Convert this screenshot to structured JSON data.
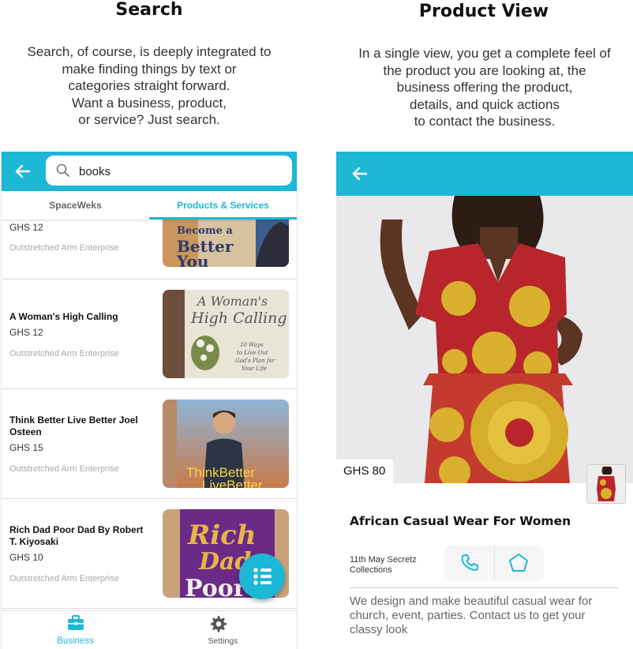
{
  "left_panel": {
    "title": "Search",
    "description": "Search, of course, is deeply integrated to\nmake finding things by text or\ncategories straight forward.\nWant a business, product,\nor service? Just search."
  },
  "right_panel": {
    "title": "Product View",
    "description": "In a single view, you get a complete feel of\nthe product you are looking at, the\nbusiness offering the product,\ndetails, and quick actions\nto contact the business."
  },
  "search_screen": {
    "search_value": "books",
    "tabs": [
      "SpaceWeks",
      "Products & Services"
    ],
    "active_tab": "Products & Services",
    "results": [
      {
        "title": "",
        "price": "GHS 12",
        "business": "Outstretched Arm Enterprise",
        "image_text": "Become a Better You"
      },
      {
        "title": "A Woman's High Calling",
        "price": "GHS 12",
        "business": "Outstretched Arm Enterprise",
        "image_text": "A Woman's High Calling"
      },
      {
        "title": "Think Better Live Better Joel Osteen",
        "price": "GHS 15",
        "business": "Outstretched Arm Enterprise",
        "image_text": "ThinkBetter LiveBetter"
      },
      {
        "title": "Rich Dad Poor Dad By Robert T. Kiyosaki",
        "price": "GHS 10",
        "business": "Outstretched Arm Enterprise",
        "image_text": "Rich Dad Poor Dad"
      }
    ],
    "bottom_nav": [
      {
        "label": "Business",
        "icon": "briefcase-icon",
        "active": true
      },
      {
        "label": "Settings",
        "icon": "gear-icon",
        "active": false
      }
    ]
  },
  "product_screen": {
    "price": "GHS 80",
    "name": "African Casual Wear For Women",
    "business": "11th May Secretz Collections",
    "actions": [
      "phone-icon",
      "pentagon-icon"
    ],
    "description": "We design and make beautiful casual wear for church, event, parties. Contact us to get your classy look"
  },
  "colors": {
    "accent": "#1cb8d6"
  }
}
